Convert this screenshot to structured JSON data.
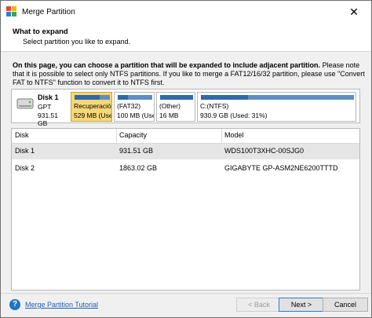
{
  "window": {
    "title": "Merge Partition",
    "close_glyph": "✕"
  },
  "header": {
    "title": "What to expand",
    "subtitle": "Select partition you like to expand."
  },
  "description": {
    "bold": "On this page, you can choose a partition that will be expanded to include adjacent partition.",
    "line1": " Please note that it is possible to select only NTFS partitions. If you like to merge a FAT12/16/32 partition, please use \"Convert FAT to NTFS\" function to convert it to NTFS first."
  },
  "disk_map": {
    "disk": {
      "name": "Disk 1",
      "type": "GPT",
      "size": "931.51 GB"
    },
    "partitions": [
      {
        "name": "Recuperació",
        "info": "529 MB (Used",
        "used": 0.7,
        "selected": true
      },
      {
        "name": "(FAT32)",
        "info": "100 MB (Used",
        "used": 0.3,
        "selected": false
      },
      {
        "name": "(Other)",
        "info": "16 MB",
        "used": 1.0,
        "selected": false
      },
      {
        "name": "C:(NTFS)",
        "info": "930.9 GB (Used: 31%)",
        "used": 0.31,
        "selected": false
      }
    ]
  },
  "grid": {
    "columns": [
      "Disk",
      "Capacity",
      "Model"
    ],
    "rows": [
      {
        "disk": "Disk 1",
        "capacity": "931.51 GB",
        "model": "WDS100T3XHC-00SJG0",
        "selected": true
      },
      {
        "disk": "Disk 2",
        "capacity": "1863.02 GB",
        "model": "GIGABYTE GP-ASM2NE6200TTTD",
        "selected": false
      }
    ]
  },
  "footer": {
    "help_glyph": "?",
    "tutorial_label": "Merge Partition Tutorial",
    "back_label": "< Back",
    "next_label": "Next >",
    "cancel_label": "Cancel"
  },
  "colors": {
    "accent": "#2f6aa8",
    "selected_partition": "#f7d776",
    "link": "#1f5fb5"
  }
}
